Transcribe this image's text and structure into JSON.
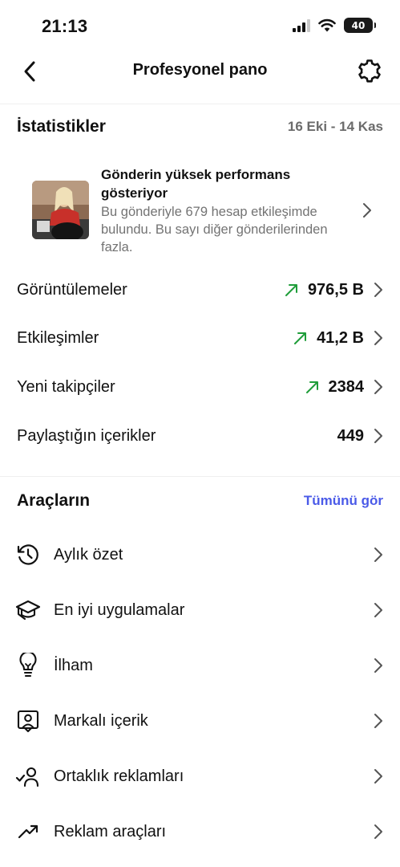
{
  "status": {
    "time": "21:13",
    "battery": "40"
  },
  "nav": {
    "title": "Profesyonel pano"
  },
  "stats": {
    "title": "İstatistikler",
    "date_range": "16 Eki - 14 Kas",
    "highlight": {
      "title": "Gönderin yüksek performans gösteriyor",
      "description": "Bu gönderiyle 679 hesap etkileşimde bulundu. Bu sayı diğer gönderilerinden fazla."
    },
    "rows": [
      {
        "label": "Görüntülemeler",
        "value": "976,5 B",
        "trend": "up"
      },
      {
        "label": "Etkileşimler",
        "value": "41,2 B",
        "trend": "up"
      },
      {
        "label": "Yeni takipçiler",
        "value": "2384",
        "trend": "up"
      },
      {
        "label": "Paylaştığın içerikler",
        "value": "449",
        "trend": ""
      }
    ]
  },
  "tools": {
    "title": "Araçların",
    "see_all": "Tümünü gör",
    "items": [
      {
        "label": "Aylık özet",
        "icon": "history-icon"
      },
      {
        "label": "En iyi uygulamalar",
        "icon": "graduation-cap-icon"
      },
      {
        "label": "İlham",
        "icon": "lightbulb-icon"
      },
      {
        "label": "Markalı içerik",
        "icon": "branded-content-icon"
      },
      {
        "label": "Ortaklık reklamları",
        "icon": "partnership-ads-icon"
      },
      {
        "label": "Reklam araçları",
        "icon": "ad-tools-icon"
      }
    ]
  },
  "colors": {
    "trend_up": "#1f9d3a",
    "link": "#4a5ae8",
    "muted": "#737373"
  }
}
